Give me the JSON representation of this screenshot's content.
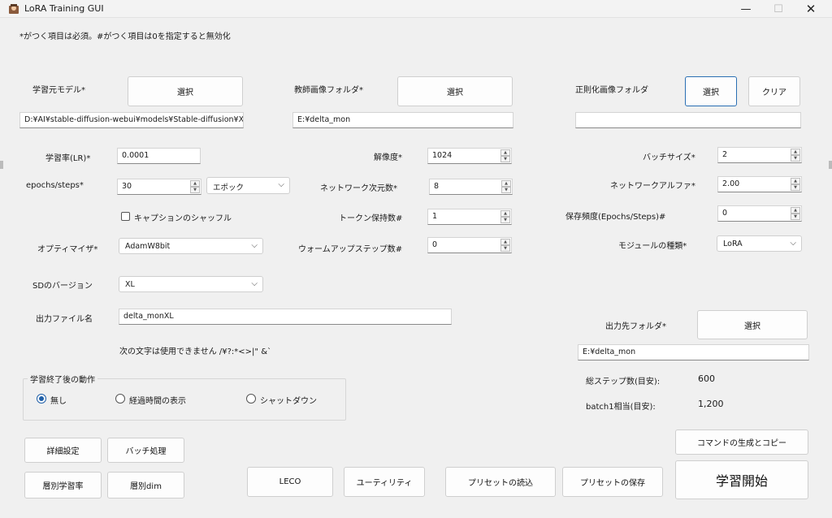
{
  "window": {
    "title": "LoRA Training GUI"
  },
  "notice": "*がつく項目は必須。#がつく項目は0を指定すると無効化",
  "sources": {
    "base_model_label": "学習元モデル*",
    "base_model_button": "選択",
    "base_model_path": "D:¥AI¥stable-diffusion-webui¥models¥Stable-diffusion¥XL¥anim",
    "teacher_label": "教師画像フォルダ*",
    "teacher_button": "選択",
    "teacher_path": "E:¥delta_mon",
    "reg_label": "正則化画像フォルダ",
    "reg_select_button": "選択",
    "reg_clear_button": "クリア",
    "reg_path": ""
  },
  "params": {
    "lr_label": "学習率(LR)*",
    "lr_value": "0.0001",
    "epochs_label": "epochs/steps*",
    "epochs_value": "30",
    "epochs_unit": "エポック",
    "caption_shuffle_label": "キャプションのシャッフル",
    "optimizer_label": "オプティマイザ*",
    "optimizer_value": "AdamW8bit",
    "sd_version_label": "SDのバージョン",
    "sd_version_value": "XL",
    "resolution_label": "解像度*",
    "resolution_value": "1024",
    "network_dim_label": "ネットワーク次元数*",
    "network_dim_value": "8",
    "keep_tokens_label": "トークン保持数#",
    "keep_tokens_value": "1",
    "warmup_label": "ウォームアップステップ数#",
    "warmup_value": "0",
    "batch_label": "バッチサイズ*",
    "batch_value": "2",
    "alpha_label": "ネットワークアルファ*",
    "alpha_value": "2.00",
    "save_freq_label": "保存頻度(Epochs/Steps)#",
    "save_freq_value": "0",
    "module_label": "モジュールの種類*",
    "module_value": "LoRA"
  },
  "output": {
    "filename_label": "出力ファイル名",
    "filename_value": "delta_monXL",
    "forbidden_note": "次の文字は使用できません /¥?:*<>|\" &`",
    "folder_label": "出力先フォルダ*",
    "folder_button": "選択",
    "folder_path": "E:¥delta_mon"
  },
  "after": {
    "group_title": "学習終了後の動作",
    "options": [
      "無し",
      "経過時間の表示",
      "シャットダウン"
    ],
    "selected": "無し"
  },
  "stats": {
    "total_steps_label": "総ステップ数(目安):",
    "total_steps_value": "600",
    "batch1_label": "batch1相当(目安):",
    "batch1_value": "1,200"
  },
  "buttons": {
    "advanced": "詳細設定",
    "batch_process": "バッチ処理",
    "layer_lr": "層別学習率",
    "layer_dim": "層別dim",
    "leco": "LECO",
    "utility": "ユーティリティ",
    "load_preset": "プリセットの読込",
    "save_preset": "プリセットの保存",
    "gen_command": "コマンドの生成とコピー",
    "start": "学習開始"
  }
}
